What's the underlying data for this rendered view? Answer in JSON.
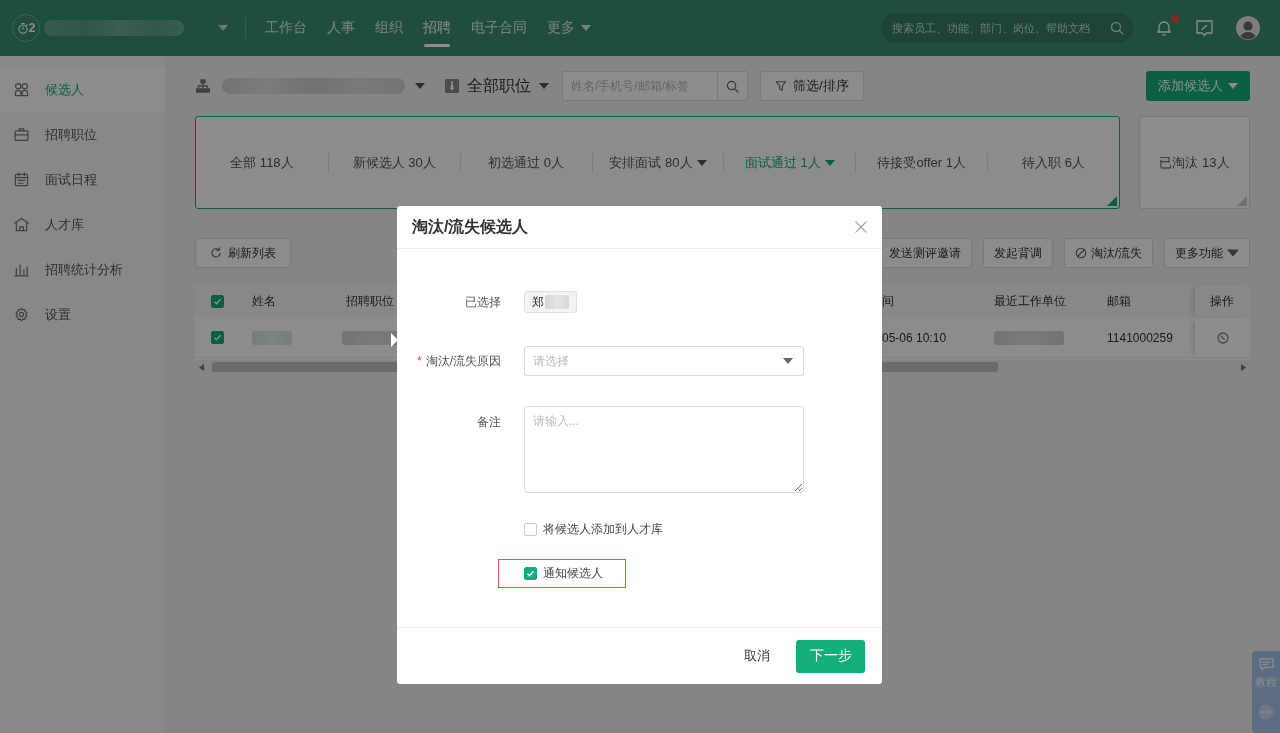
{
  "top_bar": {
    "logo_text": "2",
    "nav": [
      {
        "label": "工作台",
        "selected": false,
        "dropdown": false
      },
      {
        "label": "人事",
        "selected": false,
        "dropdown": false
      },
      {
        "label": "组织",
        "selected": false,
        "dropdown": false
      },
      {
        "label": "招聘",
        "selected": true,
        "dropdown": false
      },
      {
        "label": "电子合同",
        "selected": false,
        "dropdown": false
      },
      {
        "label": "更多",
        "selected": false,
        "dropdown": true
      }
    ],
    "search": {
      "placeholder": "搜索员工、功能、部门、岗位、帮助文档"
    },
    "notifications_unread": true
  },
  "sidebar": {
    "items": [
      {
        "label": "候选人",
        "selected": true
      },
      {
        "label": "招聘职位",
        "selected": false
      },
      {
        "label": "面试日程",
        "selected": false
      },
      {
        "label": "人才库",
        "selected": false
      },
      {
        "label": "招聘统计分析",
        "selected": false
      },
      {
        "label": "设置",
        "selected": false
      }
    ]
  },
  "toolbar": {
    "job_filter": "全部职位",
    "search": {
      "placeholder": "姓名/手机号/邮箱/标签"
    },
    "filter_button": "筛选/排序",
    "add_button": "添加候选人"
  },
  "stage_groups": [
    {
      "selected": true,
      "items": [
        {
          "text": "全部 118人",
          "selected": false,
          "dropdown": false
        },
        {
          "text": "新候选人 30人",
          "selected": false,
          "dropdown": false
        },
        {
          "text": "初选通过 0人",
          "selected": false,
          "dropdown": false
        },
        {
          "text": "安排面试 80人",
          "selected": false,
          "dropdown": true
        },
        {
          "text": "面试通过 1人",
          "selected": true,
          "dropdown": true
        },
        {
          "text": "待接受offer 1人",
          "selected": false,
          "dropdown": false
        },
        {
          "text": "待入职 6人",
          "selected": false,
          "dropdown": false
        }
      ]
    },
    {
      "selected": false,
      "items": [
        {
          "text": "已淘汰 13人",
          "selected": false,
          "dropdown": false
        }
      ]
    }
  ],
  "actions": {
    "refresh": "刷新列表",
    "buttons": [
      {
        "label": "发送测评邀请",
        "kind": "plain"
      },
      {
        "label": "发起背调",
        "kind": "plain"
      },
      {
        "label": "淘汰/流失",
        "kind": "ban"
      },
      {
        "label": "更多功能",
        "kind": "dropdown"
      }
    ]
  },
  "table": {
    "all_checked": true,
    "columns": [
      "姓名",
      "招聘职位",
      "间",
      "最近工作单位",
      "邮箱"
    ],
    "action_column": "操作",
    "rows": [
      {
        "selected": true,
        "cells": [
          {
            "kind": "blurred"
          },
          {
            "kind": "blurred"
          },
          {
            "kind": "text",
            "text": "05-06 10:10"
          },
          {
            "kind": "blurred"
          },
          {
            "kind": "text",
            "text": "1141000259"
          }
        ]
      }
    ]
  },
  "dialog": {
    "title": "淘汰/流失候选人",
    "selected_field": {
      "label": "已选择",
      "tag": "郑"
    },
    "reason_field": {
      "label": "淘汰/流失原因",
      "required_mark": "*",
      "placeholder": "请选择"
    },
    "note_field": {
      "label": "备注",
      "placeholder": "请输入..."
    },
    "options": [
      {
        "label": "将候选人添加到人才库",
        "checked": false,
        "highlighted": false
      },
      {
        "label": "通知候选人",
        "checked": true,
        "highlighted": true
      }
    ],
    "buttons": [
      {
        "label": "取消",
        "kind": "text"
      },
      {
        "label": "下一步",
        "kind": "primary"
      }
    ]
  },
  "help_tab": {
    "label": "教程"
  }
}
